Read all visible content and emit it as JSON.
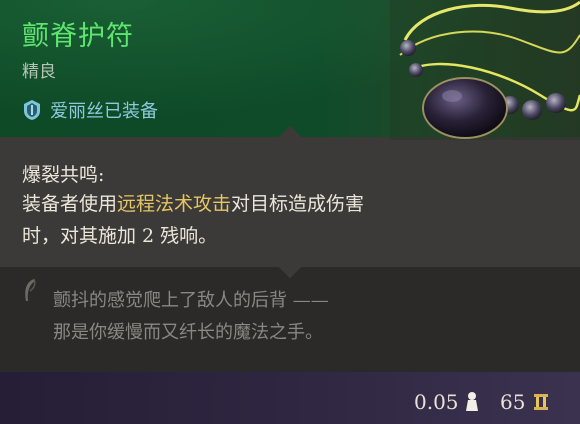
{
  "item": {
    "name": "颤脊护符",
    "rarity": "精良",
    "equipped_text": "爱丽丝已装备"
  },
  "description": {
    "title": "爆裂共鸣:",
    "part1": "装备者使用",
    "highlight": "远程法术攻击",
    "part2": "对目标造成伤害时，对其施加 2 残响。"
  },
  "flavor": {
    "line1": "颤抖的感觉爬上了敌人的后背 ——",
    "line2": "那是你缓慢而又纤长的魔法之手。"
  },
  "footer": {
    "weight": "0.05",
    "price": "65"
  },
  "icons": {
    "equipped": "helm-icon",
    "flavor": "quill-icon",
    "weight": "weight-icon",
    "price": "coin-icon"
  },
  "colors": {
    "name": "#5fe46e",
    "equipped": "#8ec8dc",
    "highlight": "#e6c563"
  }
}
